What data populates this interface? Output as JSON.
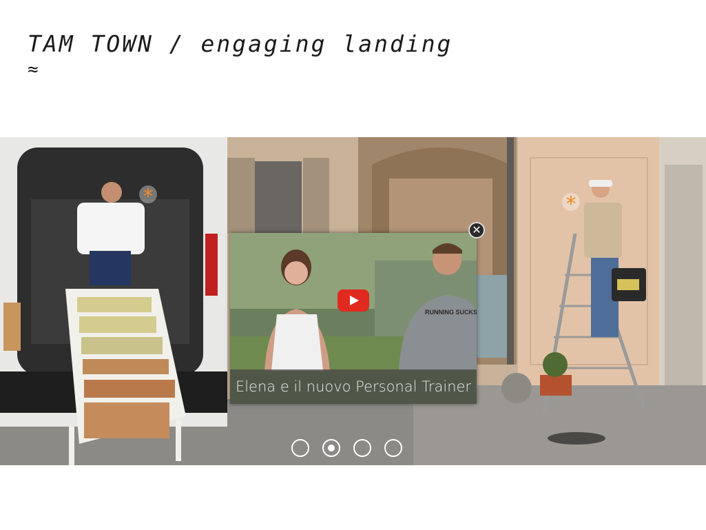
{
  "header": {
    "title": "TAM TOWN / engaging landing",
    "approx_symbol": "≈"
  },
  "hero": {
    "hotspot_symbol": "*",
    "hotspot_color": "#f58a2b",
    "video_popup": {
      "caption": "Elena e il nuovo Personal Trainer",
      "shirt_text": "RUNNING SUCKS",
      "play_icon": "youtube-play-icon",
      "close_icon": "close-icon",
      "close_symbol": "✕"
    },
    "carousel": {
      "total": 4,
      "active": 2
    }
  }
}
